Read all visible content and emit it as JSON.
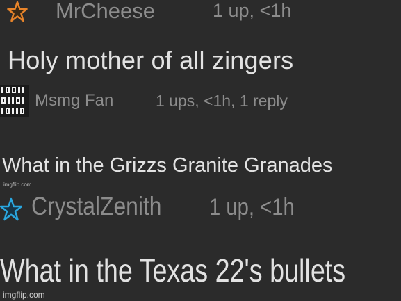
{
  "comments": [
    {
      "username": "MrCheese",
      "meta": "1 up, <1h",
      "text": "Holy mother of all zingers",
      "avatar_icon": "orange-star-icon"
    },
    {
      "username": "Msmg Fan",
      "meta": "1 ups, <1h, 1 reply",
      "text": "What in the Grizzs Granite Granades",
      "avatar_icon": "binary-pixel-icon"
    },
    {
      "username": "CrystalZenith",
      "meta": "1 up, <1h",
      "text": "What in the Texas 22's bullets",
      "avatar_icon": "blue-star-icon"
    }
  ],
  "watermarks": {
    "small": "imgflip.com",
    "bottom": "imgflip.com"
  },
  "colors": {
    "background": "#2b2b2b",
    "username": "#8c8c8c",
    "comment_text": "#e2e2e2",
    "star_orange": "#e8842a",
    "star_blue": "#2aa7e0"
  }
}
